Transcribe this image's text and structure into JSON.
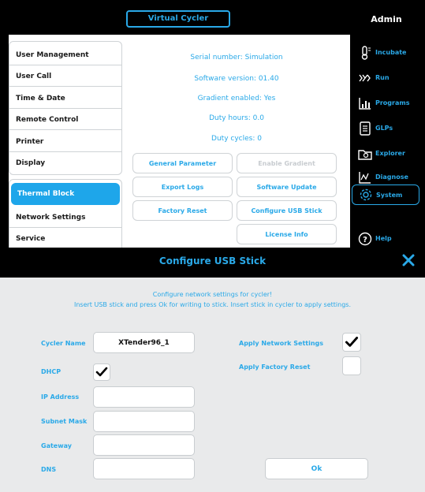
{
  "header": {
    "active_tab": "Virtual Cycler",
    "user": "Admin"
  },
  "menu": {
    "group1": [
      "User Management",
      "User Call",
      "Time & Date",
      "Remote Control",
      "Printer",
      "Display"
    ],
    "group2": [
      "Thermal Block",
      "Network Settings",
      "Service"
    ]
  },
  "info": {
    "serial": "Serial number: Simulation",
    "software": "Software version: 01.40",
    "gradient": "Gradient enabled: Yes",
    "duty_hours": "Duty hours: 0.0",
    "duty_cycles": "Duty cycles: 0"
  },
  "buttons": {
    "general_parameter": "General Parameter",
    "enable_gradient": "Enable Gradient",
    "export_logs": "Export Logs",
    "software_update": "Software Update",
    "factory_reset": "Factory Reset",
    "configure_usb": "Configure USB Stick",
    "license_info": "License Info"
  },
  "nav": {
    "incubate": "Incubate",
    "run": "Run",
    "programs": "Programs",
    "glps": "GLPs",
    "explorer": "Explorer",
    "diagnose": "Diagnose",
    "system": "System",
    "help": "Help"
  },
  "dialog": {
    "title": "Configure USB Stick",
    "intro1": "Configure network settings for cycler!",
    "intro2": "Insert USB stick and press Ok for writing to stick. Insert stick in cycler to apply settings.",
    "cycler_name_label": "Cycler Name",
    "cycler_name_value": "XTender96_1",
    "dhcp_label": "DHCP",
    "ip_label": "IP Address",
    "subnet_label": "Subnet Mask",
    "gateway_label": "Gateway",
    "dns_label": "DNS",
    "apply_network_label": "Apply Network Settings",
    "apply_factory_label": "Apply Factory Reset",
    "ok_label": "Ok",
    "dhcp_checked": true,
    "apply_network_checked": true,
    "apply_factory_checked": false
  },
  "colors": {
    "accent": "#2aa9e8",
    "active_bg": "#1ea6ea",
    "dialog_bg": "#e9eaeb"
  }
}
